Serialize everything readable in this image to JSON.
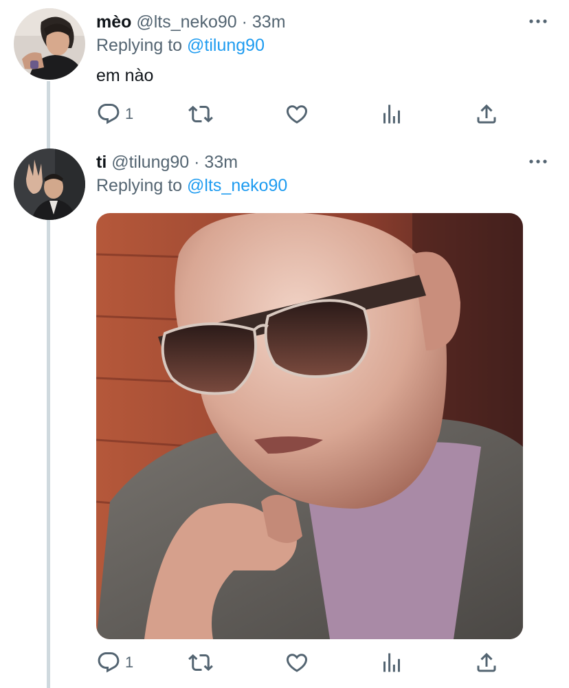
{
  "tweets": [
    {
      "name": "mèo",
      "handle": "@lts_neko90",
      "time": "· 33m",
      "replying_prefix": "Replying to",
      "replying_to": "@tilung90",
      "text": "em nào",
      "reply_count": "1",
      "icons": {
        "avatar": "profile-photo",
        "more": "more-dots-icon",
        "reply": "reply-icon",
        "retweet": "retweet-icon",
        "like": "heart-icon",
        "views": "views-icon",
        "share": "share-icon"
      }
    },
    {
      "name": "ti",
      "handle": "@tilung90",
      "time": "· 33m",
      "replying_prefix": "Replying to",
      "replying_to": "@lts_neko90",
      "reply_count": "1",
      "media": "photo of a bald man in aviator sunglasses and grey suit",
      "icons": {
        "avatar": "profile-photo",
        "more": "more-dots-icon",
        "reply": "reply-icon",
        "retweet": "retweet-icon",
        "like": "heart-icon",
        "views": "views-icon",
        "share": "share-icon"
      }
    }
  ],
  "colors": {
    "text": "#0f1419",
    "secondary": "#536471",
    "link": "#1d9bf0",
    "thread_line": "#cfd9de"
  }
}
